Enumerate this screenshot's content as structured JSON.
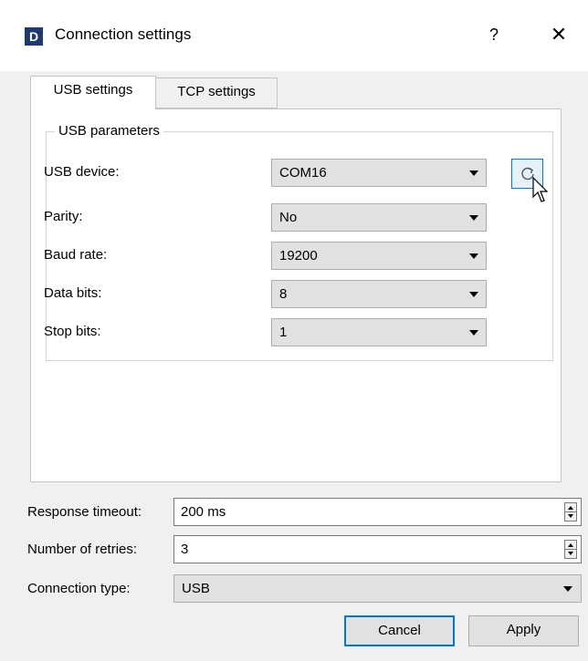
{
  "window": {
    "app_icon_letter": "D",
    "title": "Connection settings",
    "help_glyph": "?",
    "close_glyph": "✕"
  },
  "tabs": [
    {
      "label": "USB settings",
      "active": true
    },
    {
      "label": "TCP settings",
      "active": false
    }
  ],
  "usb_group": {
    "title": "USB parameters",
    "rows": [
      {
        "label": "USB device:",
        "value": "COM16"
      },
      {
        "label": "Parity:",
        "value": "No"
      },
      {
        "label": "Baud rate:",
        "value": "19200"
      },
      {
        "label": "Data bits:",
        "value": "8"
      },
      {
        "label": "Stop bits:",
        "value": "1"
      }
    ],
    "refresh_icon": "refresh-icon"
  },
  "fields": {
    "response_timeout": {
      "label": "Response timeout:",
      "value": "200 ms"
    },
    "retries": {
      "label": "Number of retries:",
      "value": "3"
    },
    "connection_type": {
      "label": "Connection type:",
      "value": "USB"
    }
  },
  "buttons": {
    "cancel": "Cancel",
    "apply": "Apply"
  },
  "colors": {
    "focus_accent": "#0078d7",
    "app_icon_bg": "#1f3a73"
  }
}
